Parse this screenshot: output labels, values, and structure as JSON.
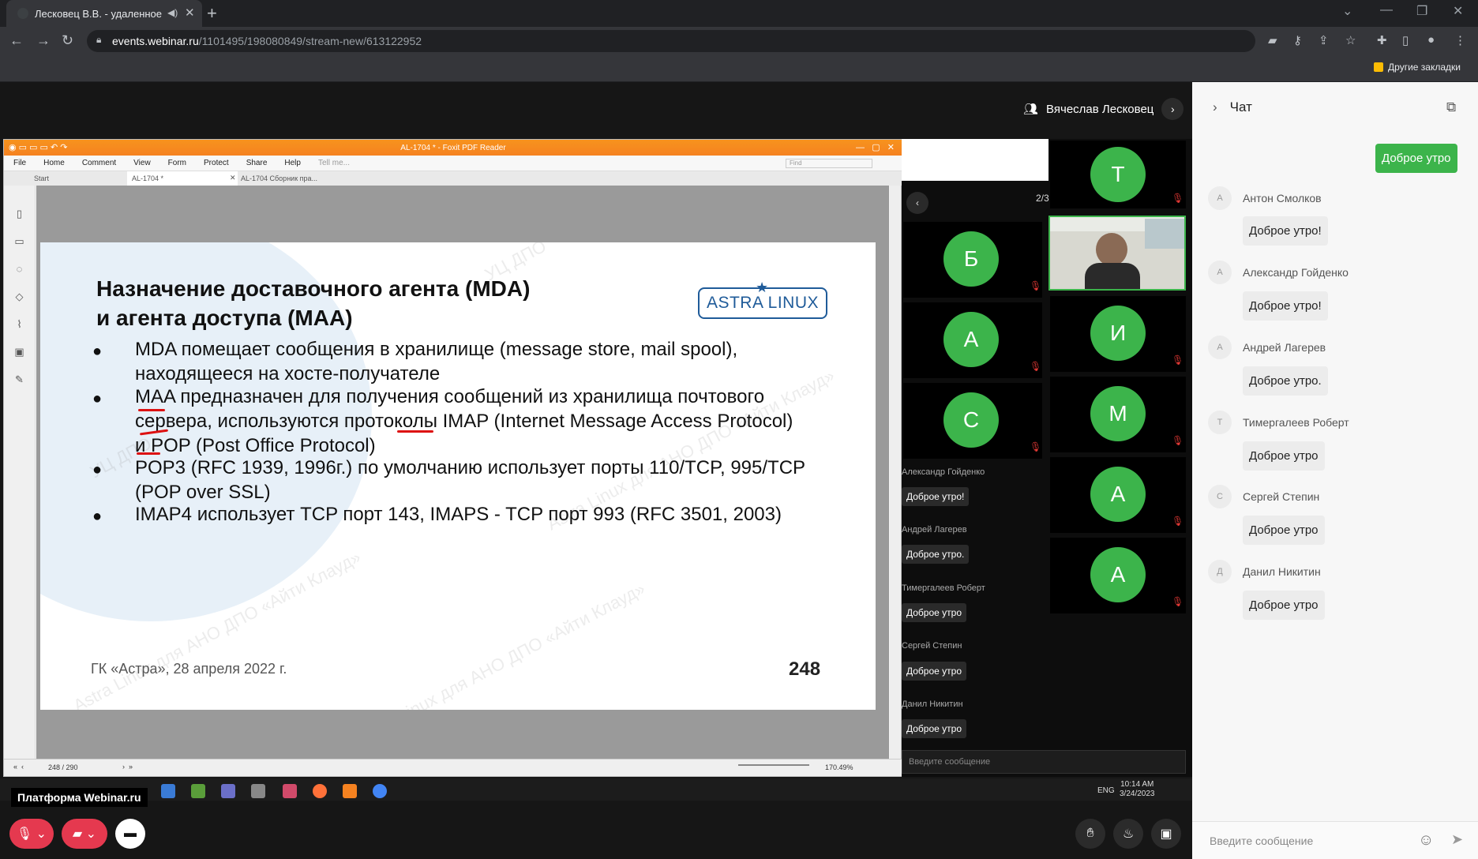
{
  "browser": {
    "tab_title": "Лесковец В.В. - удаленное",
    "url_host": "events.webinar.ru",
    "url_path": "/1101495/198080849/stream-new/613122952",
    "other_bookmarks": "Другие закладки"
  },
  "presenter": {
    "name": "Вячеслав Лесковец"
  },
  "pdf": {
    "window_title": "AL-1704 * - Foxit PDF Reader",
    "menu": [
      "File",
      "Home",
      "Comment",
      "View",
      "Form",
      "Protect",
      "Share",
      "Help"
    ],
    "tell_me": "Tell me...",
    "find": "Find",
    "tabs": [
      "Start",
      "AL-1704 *",
      "AL-1704 Сборник пра..."
    ],
    "page_indicator": "248 / 290",
    "zoom": "170.49%"
  },
  "slide": {
    "title_line1": "Назначение доставочного агента (MDA)",
    "title_line2": "и агента доступа (MAA)",
    "logo": "ASTRA LINUX",
    "bullets": [
      {
        "l1": "MDA помещает сообщения в хранилище (message store, mail spool),",
        "l2": "находящееся на хосте-получателе",
        "l3": ""
      },
      {
        "l1": "MAA предназначен для получения сообщений из хранилища почтового",
        "l2": "сервера, используются протоколы IMAP (Internet Message Access Protocol)",
        "l3": "и POP (Post Office Protocol)"
      },
      {
        "l1": "POP3 (RFC 1939, 1996г.) по умолчанию использует порты 110/TCP, 995/TCP",
        "l2": "(POP over SSL)",
        "l3": ""
      },
      {
        "l1": "IMAP4 использует TCP порт 143, IMAPS - TCP порт 993 (RFC 3501, 2003)",
        "l2": "",
        "l3": ""
      }
    ],
    "footer": "ГК «Астра», 28 апреля 2022 г.",
    "page": "248",
    "watermark": "Astra Linux для АНО ДПО «Айти Клауд»",
    "watermark_short": "УЦ ДПО"
  },
  "participants": {
    "page": "2/3",
    "tiles": [
      "Т",
      "Б",
      "А",
      "И",
      "С",
      "М",
      "А",
      "А"
    ]
  },
  "inner_chat": {
    "messages": [
      {
        "name": "Александр Гойденко",
        "text": "Доброе утро!"
      },
      {
        "name": "Андрей Лагерев",
        "text": "Доброе утро."
      },
      {
        "name": "Тимергалеев Роберт",
        "text": "Доброе утро"
      },
      {
        "name": "Сергей Степин",
        "text": "Доброе утро"
      },
      {
        "name": "Данил Никитин",
        "text": "Доброе утро"
      }
    ],
    "placeholder": "Введите сообщение"
  },
  "taskbar": {
    "brand": "Платформа Webinar.ru",
    "lang": "ENG",
    "time": "10:14 AM",
    "date": "3/24/2023"
  },
  "chat": {
    "title": "Чат",
    "my_message": "Доброе утро",
    "messages": [
      {
        "initial": "А",
        "name": "Антон Смолков",
        "text": "Доброе утро!"
      },
      {
        "initial": "А",
        "name": "Александр Гойденко",
        "text": "Доброе утро!"
      },
      {
        "initial": "А",
        "name": "Андрей Лагерев",
        "text": "Доброе утро."
      },
      {
        "initial": "Т",
        "name": "Тимергалеев Роберт",
        "text": "Доброе утро"
      },
      {
        "initial": "С",
        "name": "Сергей Степин",
        "text": "Доброе утро"
      },
      {
        "initial": "Д",
        "name": "Данил Никитин",
        "text": "Доброе утро"
      }
    ],
    "placeholder": "Введите сообщение"
  },
  "colors": {
    "accent_green": "#3cb44b",
    "mic_muted_red": "#e53935",
    "foxit_orange": "#f58220",
    "underline_red": "#d11111"
  }
}
